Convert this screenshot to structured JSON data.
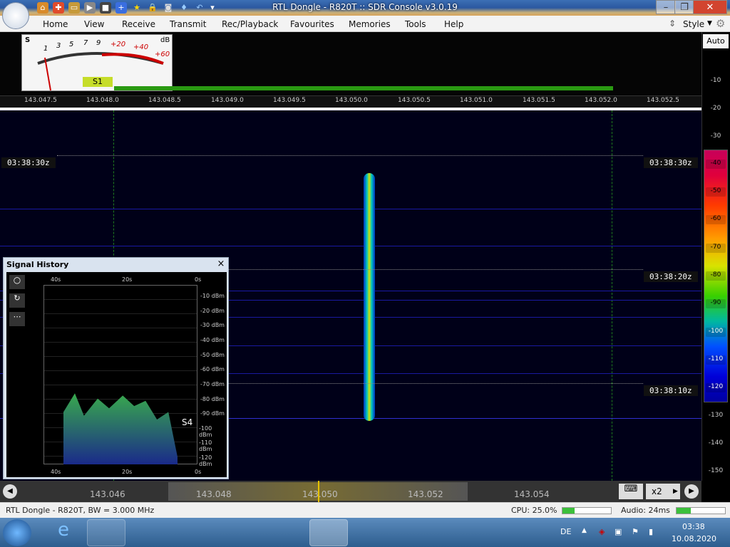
{
  "window": {
    "title": "RTL Dongle - R820T :: SDR Console v3.0.19"
  },
  "menu": {
    "items": [
      "Home",
      "View",
      "Receive",
      "Transmit",
      "Rec/Playback",
      "Favourites",
      "Memories",
      "Tools",
      "Help"
    ],
    "style": "Style"
  },
  "meter": {
    "s_label": "S",
    "db_label": "dB",
    "scale": [
      "1",
      "3",
      "5",
      "7",
      "9",
      "+20",
      "+40",
      "+60"
    ],
    "reading": "S1"
  },
  "auto_label": "Auto",
  "freq_scale": [
    "143.047.5",
    "143.048.0",
    "143.048.5",
    "143.049.0",
    "143.049.5",
    "143.050.0",
    "143.050.5",
    "143.051.0",
    "143.051.5",
    "143.052.0",
    "143.052.5"
  ],
  "db_scale": [
    "-10",
    "-20",
    "-30",
    "-40",
    "-50",
    "-60",
    "-70",
    "-80",
    "-90",
    "-100",
    "-110",
    "-120",
    "-130",
    "-140",
    "-150"
  ],
  "timestamps": [
    "03:38:30z",
    "03:38:20z",
    "03:38:10z"
  ],
  "signal_history": {
    "title": "Signal History",
    "time_top": [
      "40s",
      "20s",
      "0s"
    ],
    "time_bottom": [
      "40s",
      "20s",
      "0s"
    ],
    "dbm_labels": [
      "-10 dBm",
      "-20 dBm",
      "-30 dBm",
      "-40 dBm",
      "-50 dBm",
      "-60 dBm",
      "-70 dBm",
      "-80 dBm",
      "-90 dBm",
      "-100 dBm",
      "-110 dBm",
      "-120 dBm"
    ],
    "s_level": "S4",
    "close": "×"
  },
  "tuning": {
    "freqs": [
      "143.046",
      "143.048",
      "143.050",
      "143.052",
      "143.054"
    ],
    "zoom": "x2"
  },
  "status": {
    "device": "RTL Dongle - R820T, BW = 3.000 MHz",
    "cpu": "CPU: 25.0%",
    "audio": "Audio: 24ms",
    "cpu_level": 0.25,
    "audio_level": 0.3
  },
  "taskbar": {
    "lang": "DE",
    "time": "03:38",
    "date": "10.08.2020"
  },
  "colors": {
    "accent": "#2b58a0",
    "signal": "#38d000"
  }
}
